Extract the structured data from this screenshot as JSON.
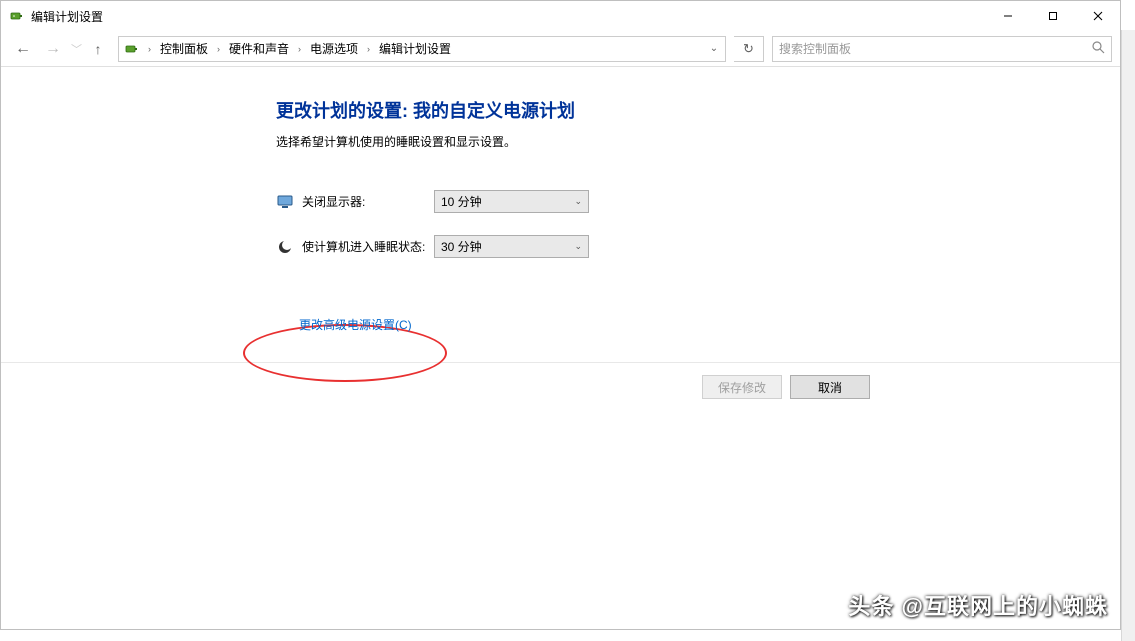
{
  "titlebar": {
    "title": "编辑计划设置"
  },
  "breadcrumb": {
    "items": [
      "控制面板",
      "硬件和声音",
      "电源选项",
      "编辑计划设置"
    ]
  },
  "search": {
    "placeholder": "搜索控制面板"
  },
  "page": {
    "heading": "更改计划的设置: 我的自定义电源计划",
    "subheading": "选择希望计算机使用的睡眠设置和显示设置。",
    "settings": [
      {
        "label": "关闭显示器:",
        "value": "10 分钟",
        "icon": "monitor-icon"
      },
      {
        "label": "使计算机进入睡眠状态:",
        "value": "30 分钟",
        "icon": "moon-icon"
      }
    ],
    "advanced_link": "更改高级电源设置(C)"
  },
  "buttons": {
    "save": "保存修改",
    "cancel": "取消"
  },
  "watermark": "头条 @互联网上的小蜘蛛"
}
